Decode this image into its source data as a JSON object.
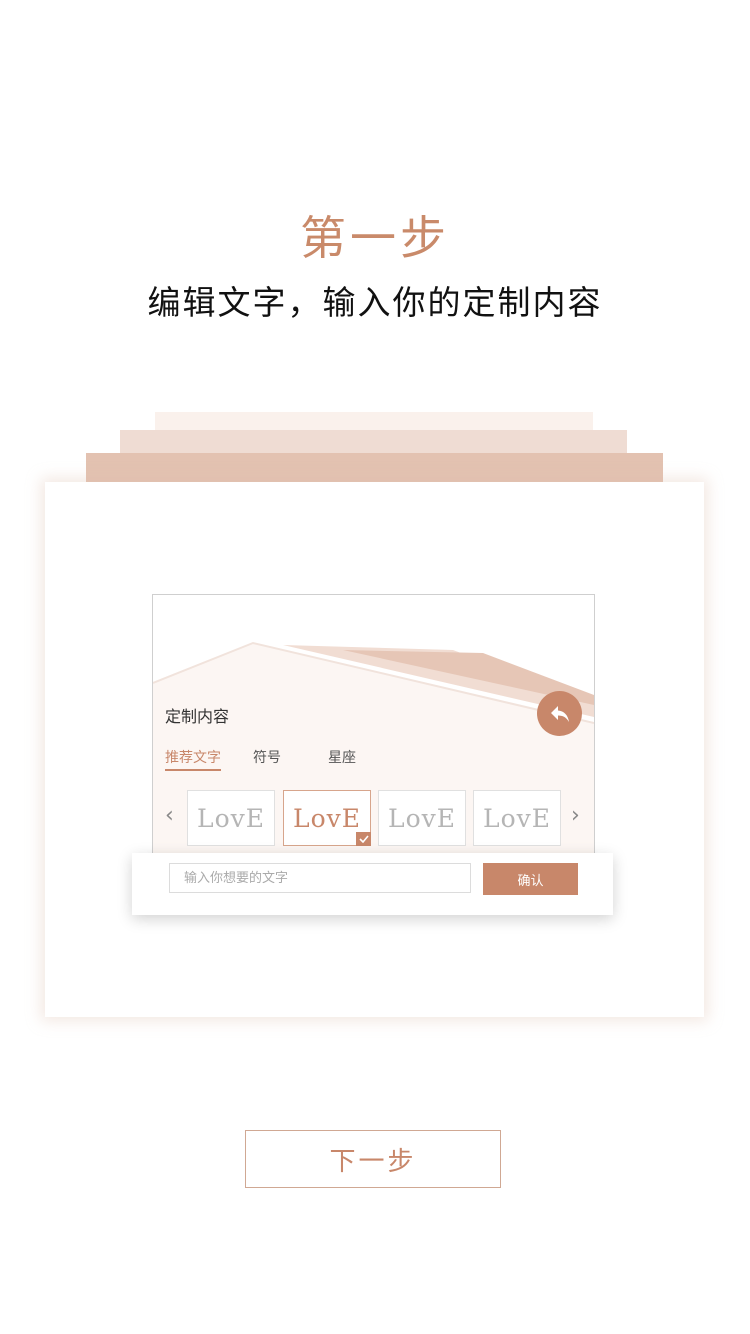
{
  "step": {
    "title": "第一步",
    "subtitle": "编辑文字，输入你的定制内容"
  },
  "mockup": {
    "title": "定制内容",
    "back_icon": "reply-arrow-icon",
    "tabs": [
      {
        "label": "推荐文字",
        "active": true
      },
      {
        "label": "符号",
        "active": false
      },
      {
        "label": "星座",
        "active": false
      }
    ],
    "options": [
      {
        "text": "LovE",
        "selected": false
      },
      {
        "text": "LovE",
        "selected": true
      },
      {
        "text": "LovE",
        "selected": false
      },
      {
        "text": "LovE",
        "selected": false
      }
    ],
    "prev_arrow": "‹",
    "next_arrow": "›"
  },
  "input": {
    "placeholder": "输入你想要的文字",
    "confirm_label": "确认"
  },
  "next_button": {
    "label": "下一步"
  },
  "colors": {
    "accent": "#c8876a",
    "title": "#c98a6a"
  }
}
